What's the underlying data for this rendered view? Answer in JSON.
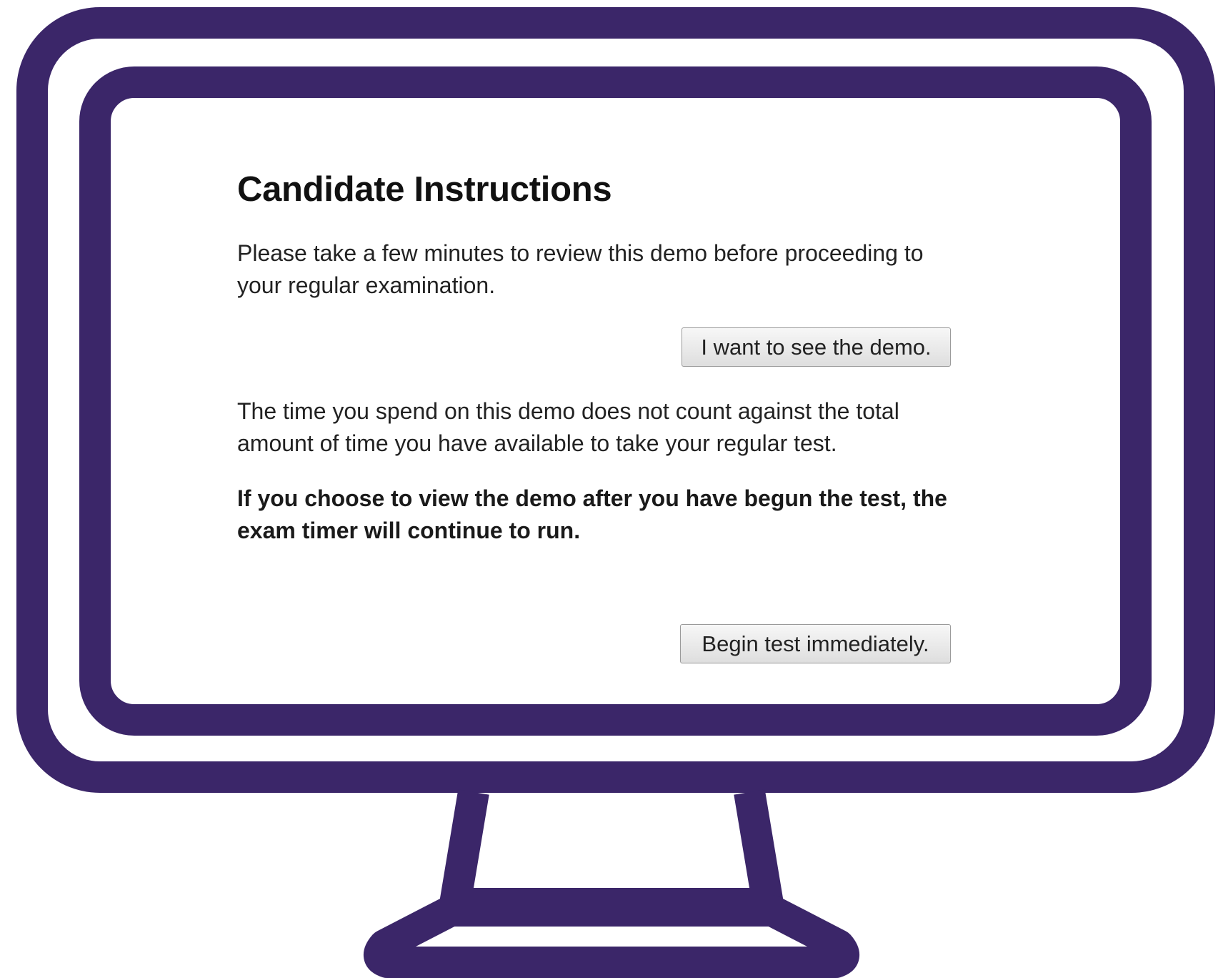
{
  "colors": {
    "monitor_frame": "#3b2669",
    "screen_background": "#ffffff",
    "button_background": "#e9e9e9"
  },
  "icons": {
    "monitor": "monitor-icon"
  },
  "instructions": {
    "title": "Candidate Instructions",
    "intro": "Please take a few minutes to review this demo before proceeding to your regular examination.",
    "demo_button_label": "I want to see the demo.",
    "time_note": "The time you spend on this demo does not count against the total amount of time you have available to take your regular test.",
    "warning": "If you choose to view the demo after you have begun the test, the exam timer will continue to run.",
    "begin_button_label": "Begin test immediately."
  }
}
